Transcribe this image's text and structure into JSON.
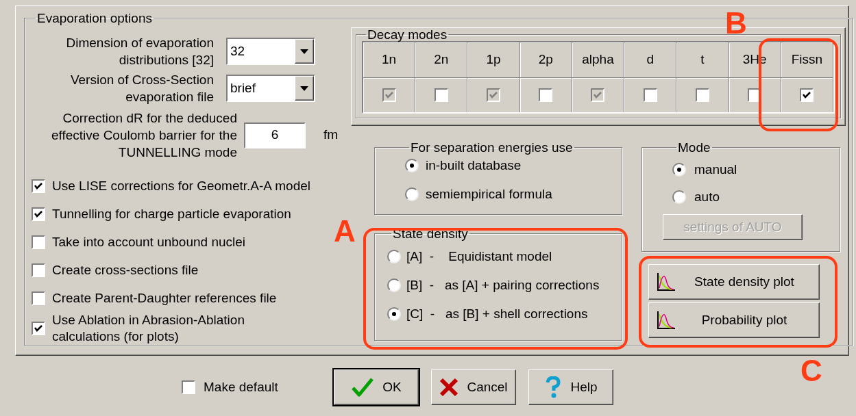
{
  "group_title": "Evaporation options",
  "fields": [
    {
      "kind": "dropdown",
      "label": "Dimension of evaporation distributions [32]",
      "value": "32"
    },
    {
      "kind": "dropdown",
      "label": "Version of Cross-Section evaporation file",
      "value": "brief"
    },
    {
      "kind": "number",
      "label": "Correction dR for the deduced effective Coulomb barrier for the TUNNELLING mode",
      "value": "6",
      "unit": "fm"
    }
  ],
  "options": [
    {
      "label": "Use LISE corrections for Geometr.A-A model",
      "checked": true
    },
    {
      "label": "Tunnelling for charge particle evaporation",
      "checked": true
    },
    {
      "label": "Take into account unbound nuclei",
      "checked": false
    },
    {
      "label": "Create cross-sections file",
      "checked": false
    },
    {
      "label": "Create Parent-Daughter references file",
      "checked": false
    },
    {
      "label": "Use Ablation in Abrasion-Ablation calculations (for plots)",
      "checked": true
    }
  ],
  "decay_modes": {
    "title": "Decay modes",
    "columns": [
      {
        "label": "1n",
        "checked": true,
        "disabled": true
      },
      {
        "label": "2n",
        "checked": false,
        "disabled": false
      },
      {
        "label": "1p",
        "checked": true,
        "disabled": true
      },
      {
        "label": "2p",
        "checked": false,
        "disabled": false
      },
      {
        "label": "alpha",
        "checked": true,
        "disabled": true
      },
      {
        "label": "d",
        "checked": false,
        "disabled": false
      },
      {
        "label": "t",
        "checked": false,
        "disabled": false
      },
      {
        "label": "3He",
        "checked": false,
        "disabled": false
      },
      {
        "label": "Fissn",
        "checked": true,
        "disabled": false
      }
    ]
  },
  "separation": {
    "title": "For separation energies use",
    "options": [
      {
        "label": "in-built database",
        "selected": true
      },
      {
        "label": "semiempirical formula",
        "selected": false
      }
    ]
  },
  "state_density": {
    "title": "State density",
    "options": [
      {
        "label": "[A]  -    Equidistant model",
        "selected": false
      },
      {
        "label": "[B]  -   as [A] + pairing corrections",
        "selected": false
      },
      {
        "label": "[C]  -   as [B] + shell corrections",
        "selected": true
      }
    ]
  },
  "mode": {
    "title": "Mode",
    "options": [
      {
        "label": "manual",
        "selected": true
      },
      {
        "label": "auto",
        "selected": false
      }
    ],
    "button": {
      "label": "settings of AUTO",
      "disabled": true
    }
  },
  "plot_buttons": [
    "State density plot",
    "Probability plot"
  ],
  "footer": {
    "make_default": {
      "label": "Make default",
      "checked": false
    },
    "buttons": [
      {
        "kind": "ok",
        "label": "OK",
        "default": true
      },
      {
        "kind": "cancel",
        "label": "Cancel",
        "default": false
      },
      {
        "kind": "help",
        "label": "Help",
        "default": false
      }
    ]
  },
  "annotations": [
    {
      "label": "A"
    },
    {
      "label": "B"
    },
    {
      "label": "C"
    }
  ]
}
